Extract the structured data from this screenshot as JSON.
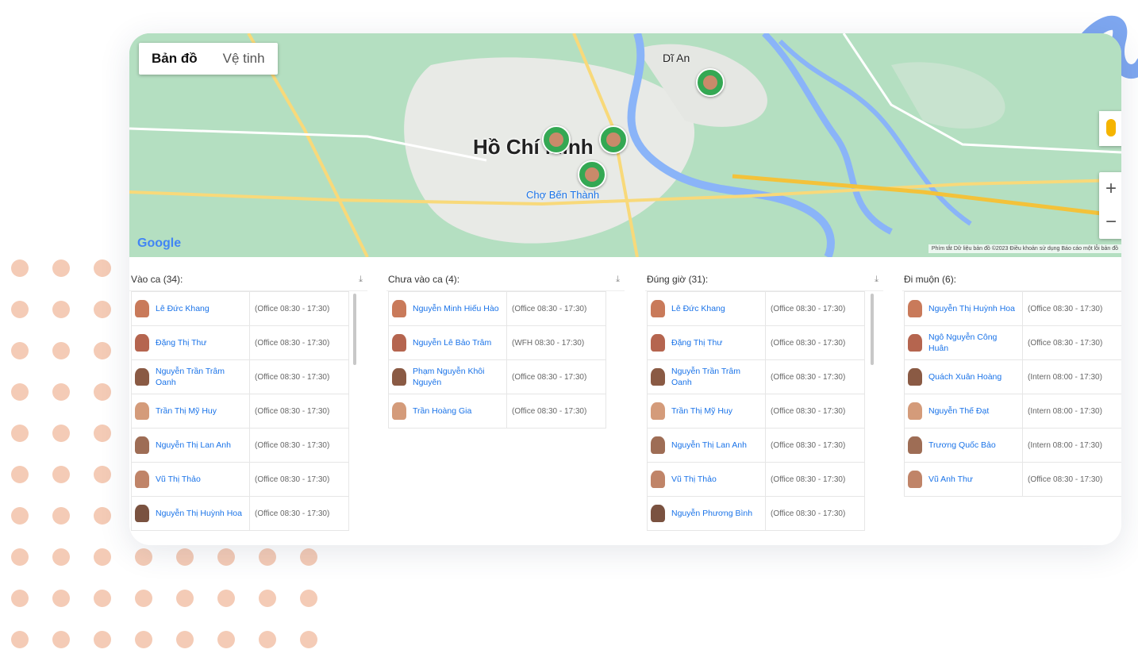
{
  "map": {
    "map_tab": "Bản đồ",
    "satellite_tab": "Vệ tinh",
    "city_label": "Hồ Chí Minh",
    "market_label": "Chợ Bến Thành",
    "district_label": "Dĩ An",
    "google_logo": "Google",
    "attribution": "Phím tắt   Dữ liệu bản đồ ©2023   Điều khoản sử dụng   Báo cáo một lỗi bản đồ",
    "zoom_in": "+",
    "zoom_out": "−"
  },
  "panels": [
    {
      "title": "Vào ca (34):",
      "rows": [
        {
          "name": "Lê Đức Khang",
          "shift": "(Office 08:30 - 17:30)"
        },
        {
          "name": "Đặng Thị Thư",
          "shift": "(Office 08:30 - 17:30)"
        },
        {
          "name": "Nguyễn Trần Trâm Oanh",
          "shift": "(Office 08:30 - 17:30)"
        },
        {
          "name": "Trần Thị Mỹ Huy",
          "shift": "(Office 08:30 - 17:30)"
        },
        {
          "name": "Nguyễn Thị Lan Anh",
          "shift": "(Office 08:30 - 17:30)"
        },
        {
          "name": "Vũ Thị Thảo",
          "shift": "(Office 08:30 - 17:30)"
        },
        {
          "name": "Nguyễn Thị Huỳnh Hoa",
          "shift": "(Office 08:30 - 17:30)"
        }
      ]
    },
    {
      "title": "Chưa vào ca (4):",
      "rows": [
        {
          "name": "Nguyễn Minh Hiếu Hào",
          "shift": "(Office 08:30 - 17:30)"
        },
        {
          "name": "Nguyễn Lê Bảo Trâm",
          "shift": "(WFH 08:30 - 17:30)"
        },
        {
          "name": "Phạm Nguyễn Khôi Nguyên",
          "shift": "(Office 08:30 - 17:30)"
        },
        {
          "name": "Trần Hoàng Gia",
          "shift": "(Office 08:30 - 17:30)"
        }
      ]
    },
    {
      "title": "Đúng giờ (31):",
      "rows": [
        {
          "name": "Lê Đức Khang",
          "shift": "(Office 08:30 - 17:30)"
        },
        {
          "name": "Đặng Thị Thư",
          "shift": "(Office 08:30 - 17:30)"
        },
        {
          "name": "Nguyễn Trần Trâm Oanh",
          "shift": "(Office 08:30 - 17:30)"
        },
        {
          "name": "Trần Thị Mỹ Huy",
          "shift": "(Office 08:30 - 17:30)"
        },
        {
          "name": "Nguyễn Thị Lan Anh",
          "shift": "(Office 08:30 - 17:30)"
        },
        {
          "name": "Vũ Thị Thảo",
          "shift": "(Office 08:30 - 17:30)"
        },
        {
          "name": "Nguyễn Phương Bình",
          "shift": "(Office 08:30 - 17:30)"
        }
      ]
    },
    {
      "title": "Đi muộn (6):",
      "rows": [
        {
          "name": "Nguyễn Thị Huỳnh Hoa",
          "shift": "(Office 08:30 - 17:30)"
        },
        {
          "name": "Ngô Nguyễn Công Huân",
          "shift": "(Office 08:30 - 17:30)"
        },
        {
          "name": "Quách Xuân Hoàng",
          "shift": "(Intern 08:00 - 17:30)"
        },
        {
          "name": "Nguyễn Thế Đạt",
          "shift": "(Intern 08:00 - 17:30)"
        },
        {
          "name": "Trương Quốc Bảo",
          "shift": "(Intern 08:00 - 17:30)"
        },
        {
          "name": "Vũ Anh Thư",
          "shift": "(Office 08:30 - 17:30)"
        }
      ]
    }
  ],
  "colors": {
    "link": "#1a73e8",
    "map_green": "#a9d9b8",
    "pin": "#34a853",
    "dots": "#f2c4ad"
  }
}
